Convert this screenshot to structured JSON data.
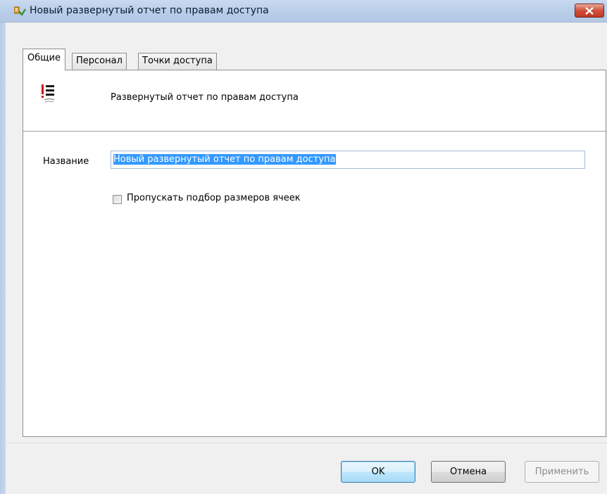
{
  "window": {
    "title": "Новый развернутый отчет по правам доступа",
    "icon": "report-app-icon"
  },
  "tabs": [
    {
      "label": "Общие",
      "active": true
    },
    {
      "label": "Персонал",
      "active": false
    },
    {
      "label": "Точки доступа",
      "active": false
    }
  ],
  "general": {
    "description": "Развернутый отчет по правам доступа",
    "description_icon": "report-list-icon",
    "name_label": "Название",
    "name_value": "Новый развернутый отчет по правам доступа",
    "checkbox_label": "Пропускать подбор размеров ячеек",
    "checkbox_checked": false
  },
  "buttons": {
    "ok": "OK",
    "cancel": "Отмена",
    "apply": "Применить"
  },
  "colors": {
    "selection": "#3399ff",
    "icon_red": "#cc1a1a",
    "close_button": "#c7432e"
  }
}
